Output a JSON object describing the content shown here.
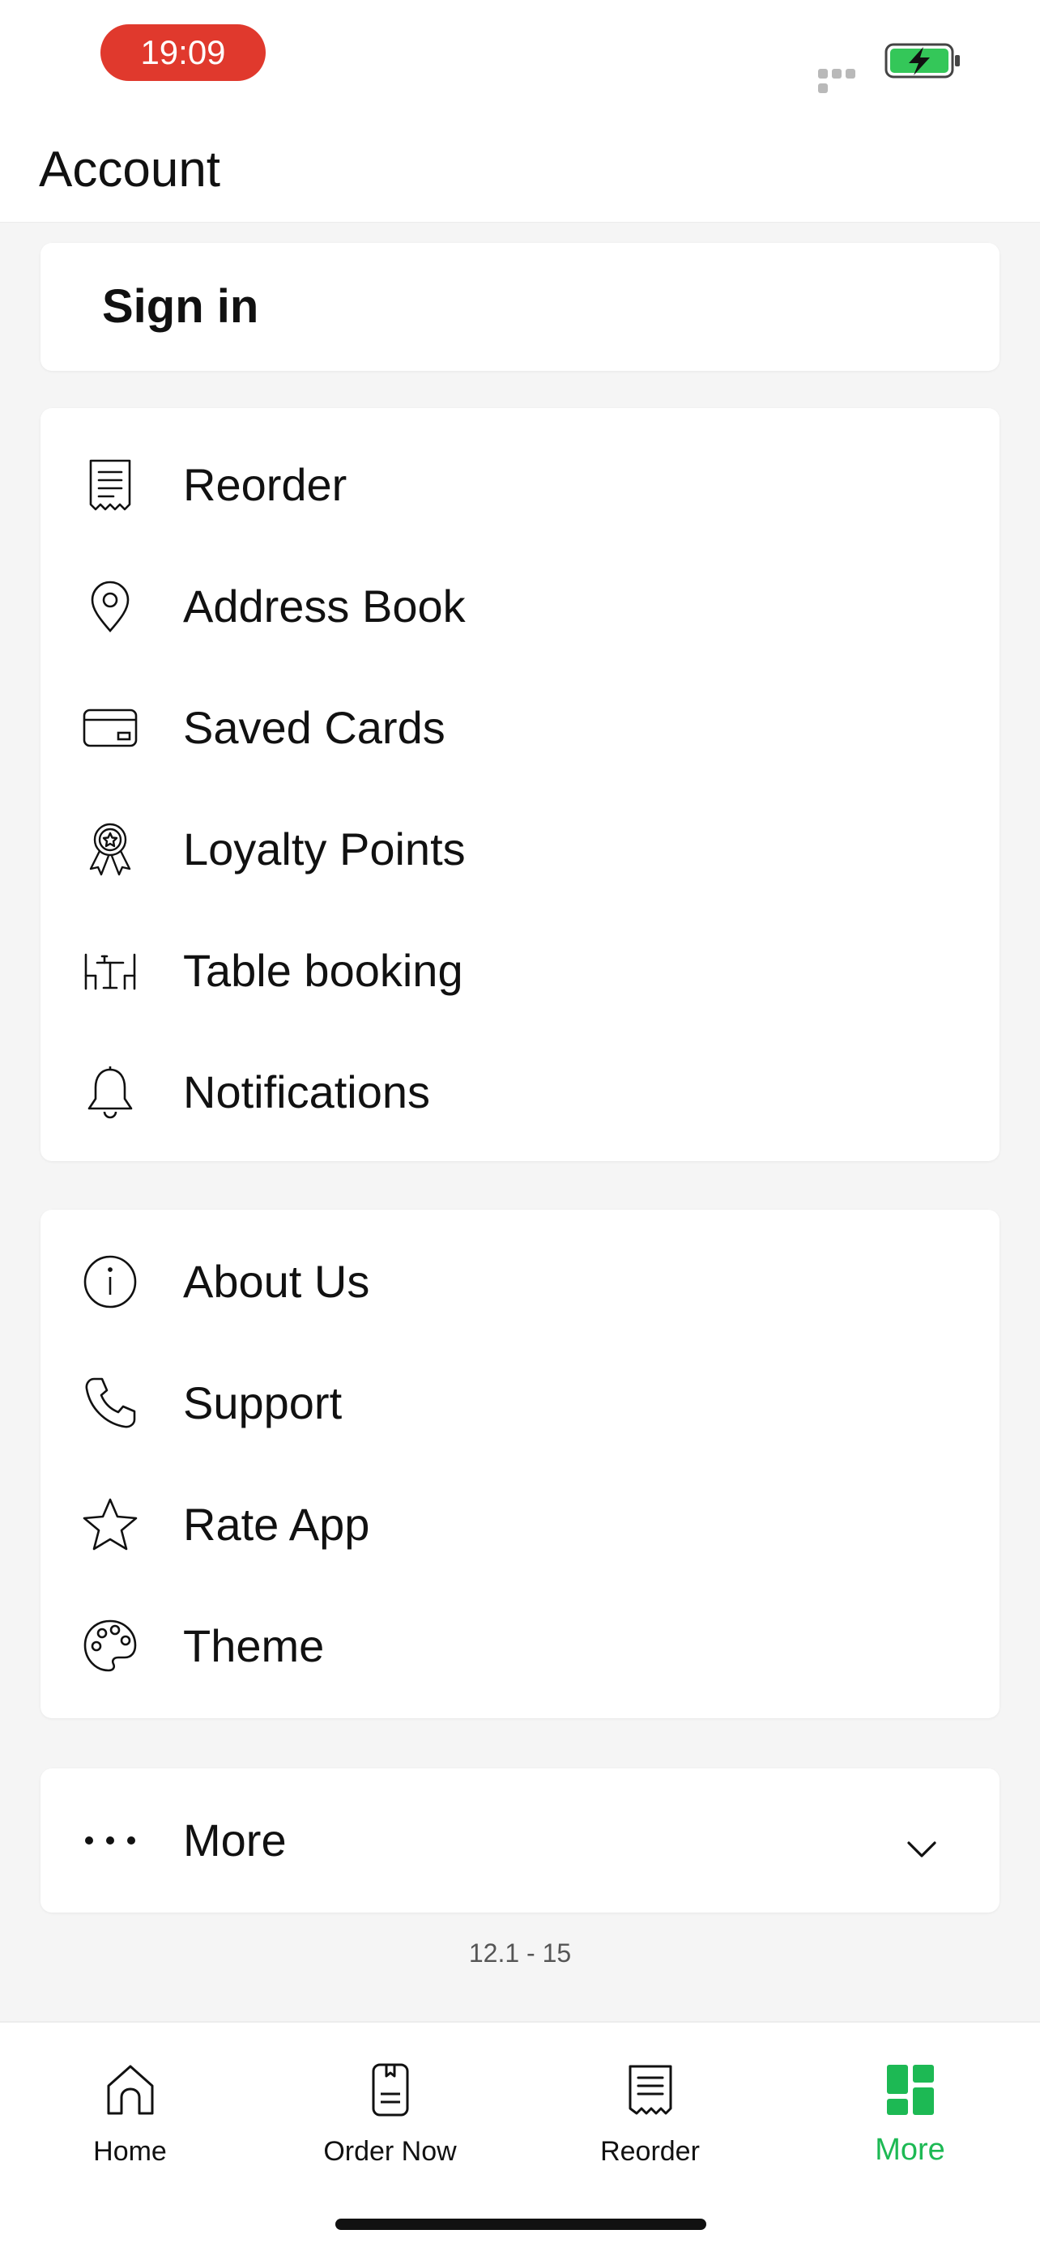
{
  "status_bar": {
    "time": "19:09",
    "battery_icon": "battery-charging-icon",
    "signal_icon": "signal-icon",
    "time_pill_color": "#e0392d"
  },
  "header": {
    "title": "Account"
  },
  "signin": {
    "label": "Sign in"
  },
  "menu_group_1": [
    {
      "label": "Reorder",
      "icon": "receipt-icon"
    },
    {
      "label": "Address Book",
      "icon": "location-pin-icon"
    },
    {
      "label": "Saved Cards",
      "icon": "credit-card-icon"
    },
    {
      "label": "Loyalty Points",
      "icon": "award-ribbon-icon"
    },
    {
      "label": "Table booking",
      "icon": "table-chairs-icon"
    },
    {
      "label": "Notifications",
      "icon": "bell-icon"
    }
  ],
  "menu_group_2": [
    {
      "label": "About Us",
      "icon": "info-icon"
    },
    {
      "label": "Support",
      "icon": "phone-icon"
    },
    {
      "label": "Rate App",
      "icon": "star-icon"
    },
    {
      "label": "Theme",
      "icon": "palette-icon"
    }
  ],
  "more": {
    "label": "More",
    "icon": "ellipsis-icon",
    "expand_icon": "chevron-down-icon"
  },
  "version": "12.1 - 15",
  "tabbar": {
    "active": "More",
    "accent_color": "#1db954",
    "tabs": [
      {
        "label": "Home",
        "icon": "home-icon"
      },
      {
        "label": "Order Now",
        "icon": "menu-book-icon"
      },
      {
        "label": "Reorder",
        "icon": "receipt-icon"
      },
      {
        "label": "More",
        "icon": "grid-icon"
      }
    ]
  }
}
